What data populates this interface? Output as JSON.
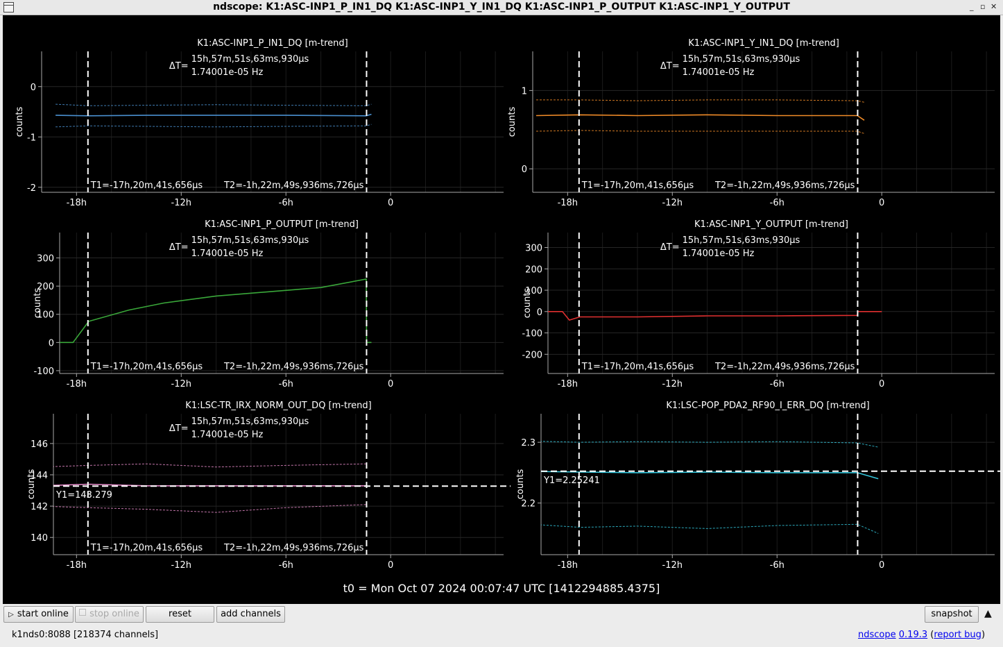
{
  "window": {
    "title": "ndscope: K1:ASC-INP1_P_IN1_DQ K1:ASC-INP1_Y_IN1_DQ K1:ASC-INP1_P_OUTPUT K1:ASC-INP1_Y_OUTPUT",
    "minimize": "_",
    "maximize": "▫",
    "close": "✕"
  },
  "cursors": {
    "delta_label": "ΔT=",
    "delta_line1": "15h,57m,51s,63ms,930µs",
    "delta_line2": "1.74001e-05 Hz",
    "t1_text": "T1=-17h,20m,41s,656µs",
    "t2_text": "T2=-1h,22m,49s,936ms,726µs",
    "t1_hours": -17.345,
    "t2_hours": -1.381
  },
  "x_axis": {
    "min_hours": -20,
    "max_hours": 6,
    "ticks": [
      -18,
      -12,
      -6,
      0
    ],
    "tick_labels": [
      "-18h",
      "-12h",
      "-6h",
      "0"
    ]
  },
  "colors": {
    "blue": "#4a90d0",
    "orange": "#f28c28",
    "green": "#3aa83a",
    "red": "#e23030",
    "pink": "#e48ac8",
    "cyan": "#33c6dc"
  },
  "chart_data": [
    {
      "type": "line",
      "title": "K1:ASC-INP1_P_IN1_DQ [m-trend]",
      "ylabel": "counts",
      "ylim": [
        -2.1,
        0.7
      ],
      "yticks": [
        0,
        -1,
        -2
      ],
      "color": "blue",
      "series": [
        {
          "role": "max",
          "x": [
            -19.2,
            -17.3,
            -14,
            -10,
            -6,
            -1.4,
            -1.1
          ],
          "values": [
            -0.35,
            -0.38,
            -0.37,
            -0.36,
            -0.37,
            -0.38,
            -0.35
          ]
        },
        {
          "role": "mean",
          "x": [
            -19.2,
            -17.3,
            -14,
            -10,
            -6,
            -1.4,
            -1.1
          ],
          "values": [
            -0.57,
            -0.58,
            -0.57,
            -0.57,
            -0.57,
            -0.58,
            -0.55
          ]
        },
        {
          "role": "min",
          "x": [
            -19.2,
            -17.3,
            -14,
            -10,
            -6,
            -1.4,
            -1.1
          ],
          "values": [
            -0.8,
            -0.78,
            -0.79,
            -0.8,
            -0.79,
            -0.78,
            -0.75
          ]
        }
      ],
      "show_delta": true,
      "show_t1": true,
      "show_t2": true,
      "y_cursor": null
    },
    {
      "type": "line",
      "title": "K1:ASC-INP1_Y_IN1_DQ [m-trend]",
      "ylabel": "counts",
      "ylim": [
        -0.3,
        1.5
      ],
      "yticks": [
        1,
        0
      ],
      "color": "orange",
      "series": [
        {
          "role": "max",
          "x": [
            -19.8,
            -17.3,
            -14,
            -10,
            -6,
            -1.4,
            -1.0
          ],
          "values": [
            0.88,
            0.88,
            0.87,
            0.88,
            0.88,
            0.87,
            0.85
          ]
        },
        {
          "role": "mean",
          "x": [
            -19.8,
            -17.3,
            -14,
            -10,
            -6,
            -1.4,
            -1.0
          ],
          "values": [
            0.68,
            0.69,
            0.68,
            0.69,
            0.68,
            0.68,
            0.62
          ]
        },
        {
          "role": "min",
          "x": [
            -19.8,
            -17.3,
            -14,
            -10,
            -6,
            -1.4,
            -1.0
          ],
          "values": [
            0.48,
            0.49,
            0.48,
            0.48,
            0.48,
            0.48,
            0.45
          ]
        }
      ],
      "show_delta": true,
      "show_t1": true,
      "show_t2": true,
      "y_cursor": null
    },
    {
      "type": "line",
      "title": "K1:ASC-INP1_P_OUTPUT [m-trend]",
      "ylabel": "counts",
      "ylim": [
        -110,
        390
      ],
      "yticks": [
        300,
        200,
        100,
        0,
        -100
      ],
      "color": "green",
      "series": [
        {
          "role": "mean",
          "x": [
            -20,
            -18.8,
            -18.2,
            -17.3,
            -15,
            -13,
            -10,
            -7,
            -4,
            -1.4,
            -1.38,
            -1.1
          ],
          "values": [
            0,
            0,
            0,
            75,
            115,
            140,
            165,
            180,
            195,
            225,
            0,
            0
          ]
        }
      ],
      "show_delta": true,
      "show_t1": true,
      "show_t2": true,
      "y_cursor": null
    },
    {
      "type": "line",
      "title": "K1:ASC-INP1_Y_OUTPUT [m-trend]",
      "ylabel": "counts",
      "ylim": [
        -290,
        370
      ],
      "yticks": [
        300,
        200,
        100,
        0,
        -100,
        -200
      ],
      "color": "red",
      "series": [
        {
          "role": "mean",
          "x": [
            -20,
            -18.3,
            -17.9,
            -17.3,
            -14,
            -10,
            -6,
            -1.4,
            -1.38,
            0
          ],
          "values": [
            0,
            0,
            -40,
            -25,
            -25,
            -20,
            -20,
            -18,
            0,
            0
          ]
        }
      ],
      "show_delta": true,
      "show_t1": true,
      "show_t2": true,
      "y_cursor": null
    },
    {
      "type": "line",
      "title": "K1:LSC-TR_IRX_NORM_OUT_DQ [m-trend]",
      "ylabel": "counts",
      "ylim": [
        138.9,
        147.9
      ],
      "yticks": [
        146,
        144,
        142,
        140
      ],
      "color": "pink",
      "series": [
        {
          "role": "max",
          "x": [
            -20,
            -17.3,
            -14,
            -10,
            -6,
            -1.4
          ],
          "values": [
            144.5,
            144.6,
            144.7,
            144.5,
            144.6,
            144.7
          ]
        },
        {
          "role": "mean",
          "x": [
            -20,
            -17.3,
            -14,
            -10,
            -6,
            -1.4
          ],
          "values": [
            143.3,
            143.4,
            143.3,
            143.3,
            143.3,
            143.3
          ]
        },
        {
          "role": "min",
          "x": [
            -20,
            -17.3,
            -14,
            -10,
            -6,
            -1.4
          ],
          "values": [
            142.0,
            141.9,
            141.8,
            141.6,
            141.9,
            142.1
          ]
        }
      ],
      "show_delta": true,
      "show_t1": true,
      "show_t2": true,
      "y_cursor": {
        "value": 143.279,
        "label": "Y1=143.279"
      }
    },
    {
      "type": "line",
      "title": "K1:LSC-POP_PDA2_RF90_I_ERR_DQ [m-trend]",
      "ylabel": "counts",
      "ylim": [
        2.115,
        2.347
      ],
      "yticks": [
        2.3,
        2.2
      ],
      "color": "cyan",
      "series": [
        {
          "role": "max",
          "x": [
            -20,
            -17.3,
            -14,
            -10,
            -6,
            -1.4,
            -0.2
          ],
          "values": [
            2.302,
            2.3,
            2.301,
            2.3,
            2.301,
            2.299,
            2.292
          ]
        },
        {
          "role": "mean",
          "x": [
            -20,
            -17.3,
            -14,
            -10,
            -6,
            -1.4,
            -0.2
          ],
          "values": [
            2.252,
            2.251,
            2.25,
            2.251,
            2.25,
            2.25,
            2.24
          ]
        },
        {
          "role": "min",
          "x": [
            -20,
            -17.3,
            -14,
            -10,
            -6,
            -1.4,
            -0.2
          ],
          "values": [
            2.165,
            2.16,
            2.162,
            2.158,
            2.163,
            2.165,
            2.15
          ]
        }
      ],
      "show_delta": false,
      "show_t1": false,
      "show_t2": false,
      "y_cursor": {
        "value": 2.25241,
        "label": "Y1=2.25241"
      }
    }
  ],
  "t0_label": "t0 = Mon Oct 07 2024 00:07:47 UTC [1412294885.4375]",
  "toolbar": {
    "start_online": "start online",
    "stop_online": "stop online",
    "reset": "reset",
    "add_channels": "add channels",
    "snapshot": "snapshot"
  },
  "status": {
    "server": "k1nds0:8088",
    "channels": "[218374 channels]",
    "app_name": "ndscope",
    "version": "0.19.3",
    "open_paren": "(",
    "report_bug": "report bug",
    "close_paren": ")"
  }
}
